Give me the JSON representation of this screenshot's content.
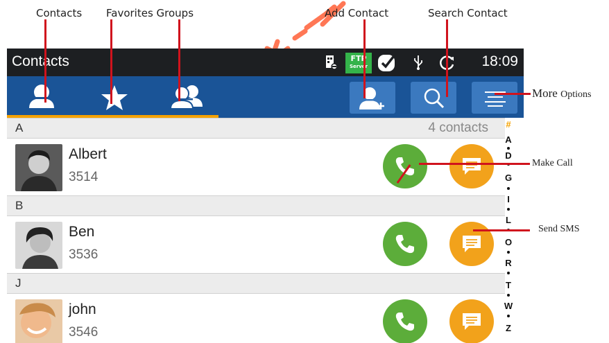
{
  "annotations": {
    "contacts": "Contacts",
    "favorites_groups": "Favorites Groups",
    "add_contact": "Add Contact",
    "search_contact": "Search Contact",
    "more_options_big": "More",
    "more_options_small": "Options",
    "make_call": "Make Call",
    "send_sms": "Send SMS"
  },
  "statusbar": {
    "title": "Contacts",
    "clock": "18:09",
    "ftp_label": "FTP",
    "ftp_sub": "Server"
  },
  "tabs": [
    {
      "name": "contacts",
      "icon": "person-icon"
    },
    {
      "name": "favorites",
      "icon": "star-icon"
    },
    {
      "name": "groups",
      "icon": "group-icon"
    }
  ],
  "actions": [
    {
      "name": "add-contact",
      "icon": "add-person-icon"
    },
    {
      "name": "search",
      "icon": "search-icon"
    },
    {
      "name": "more-options",
      "icon": "menu-lines-icon"
    }
  ],
  "contacts": {
    "count_label": "4 contacts",
    "sections": [
      {
        "letter": "A",
        "entries": [
          {
            "name": "Albert",
            "number": "3514"
          }
        ]
      },
      {
        "letter": "B",
        "entries": [
          {
            "name": "Ben",
            "number": "3536"
          }
        ]
      },
      {
        "letter": "J",
        "entries": [
          {
            "name": "john",
            "number": "3546"
          }
        ]
      }
    ]
  },
  "alphabet_index": [
    "#",
    "A",
    "D",
    "G",
    "I",
    "L",
    "O",
    "R",
    "T",
    "W",
    "Z"
  ],
  "colors": {
    "tabbar": "#1a5497",
    "accent": "#f5a200",
    "call": "#5cad3a",
    "sms": "#f2a21b",
    "callout": "#d0131d"
  }
}
